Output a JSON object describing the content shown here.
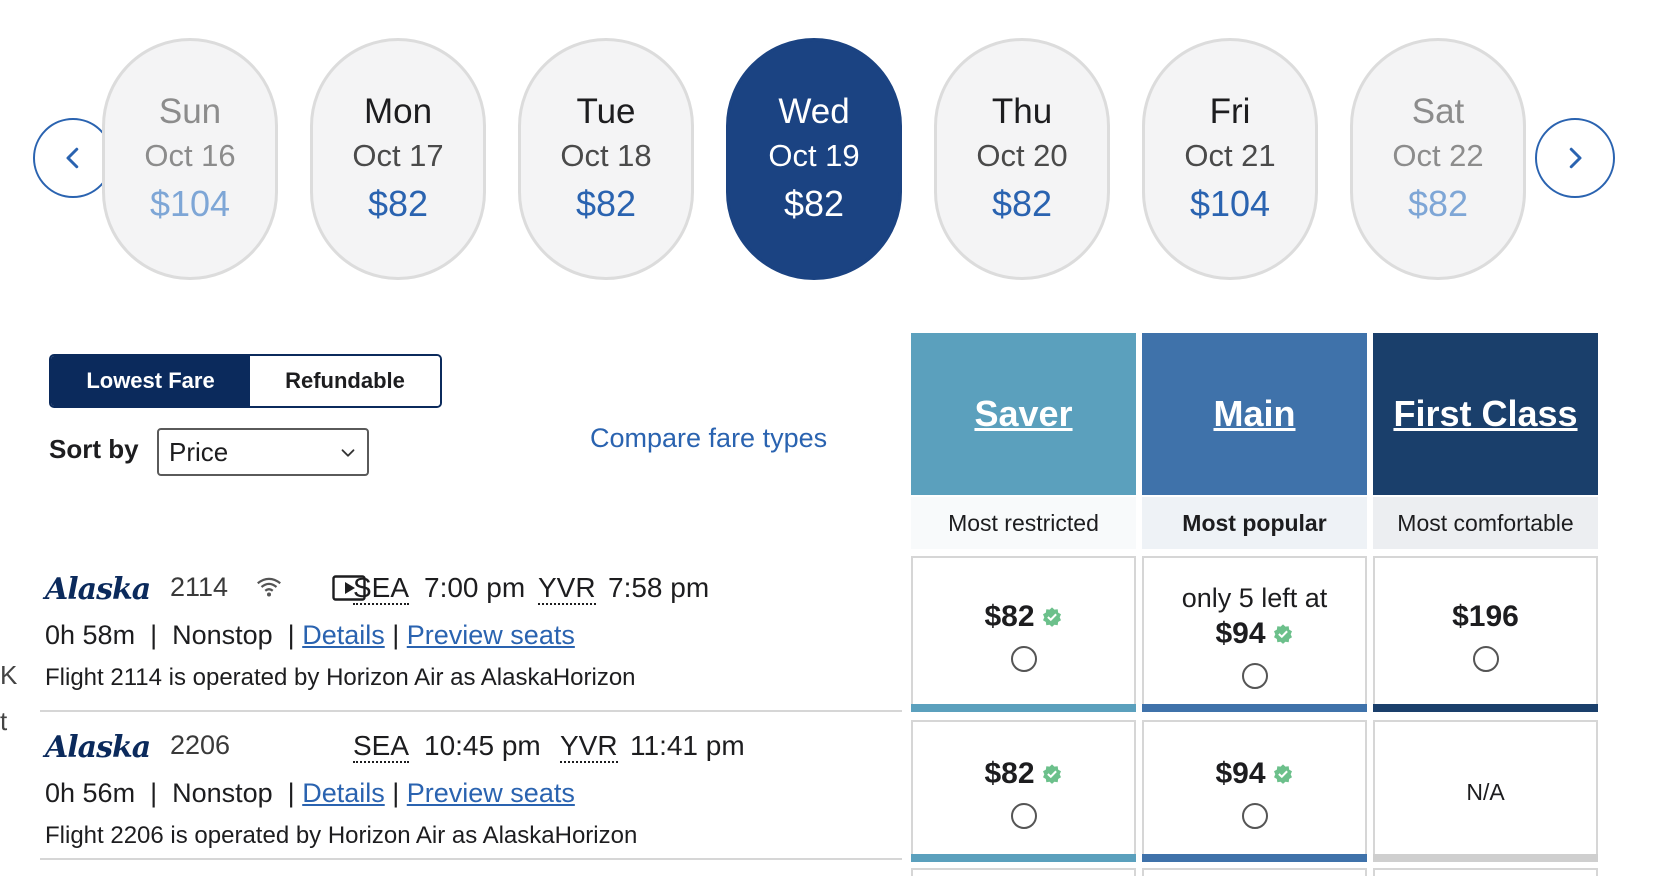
{
  "carousel": {
    "days": [
      {
        "dow": "Sun",
        "date": "Oct 16",
        "price": "$104"
      },
      {
        "dow": "Mon",
        "date": "Oct 17",
        "price": "$82"
      },
      {
        "dow": "Tue",
        "date": "Oct 18",
        "price": "$82"
      },
      {
        "dow": "Wed",
        "date": "Oct 19",
        "price": "$82"
      },
      {
        "dow": "Thu",
        "date": "Oct 20",
        "price": "$82"
      },
      {
        "dow": "Fri",
        "date": "Oct 21",
        "price": "$104"
      },
      {
        "dow": "Sat",
        "date": "Oct 22",
        "price": "$82"
      }
    ],
    "selected_index": 3,
    "prev_icon": "chevron-left-icon",
    "next_icon": "chevron-right-icon"
  },
  "filters": {
    "toggle": {
      "lowest": "Lowest Fare",
      "refundable": "Refundable",
      "active": "Lowest Fare"
    },
    "sort_label": "Sort by",
    "sort_value": "Price",
    "compare_link": "Compare fare types"
  },
  "fare_columns": [
    {
      "name": "Saver",
      "subtitle": "Most restricted",
      "color": "#5ba0bd"
    },
    {
      "name": "Main",
      "subtitle": "Most popular",
      "color": "#3f72aa"
    },
    {
      "name": "First Class",
      "subtitle": "Most comfortable",
      "color": "#1a3f6b"
    }
  ],
  "flights": [
    {
      "airline": "Alaska",
      "number": "2114",
      "amenities": [
        "wifi-icon",
        "entertainment-icon"
      ],
      "from": "SEA",
      "depart": "7:00 pm",
      "to": "YVR",
      "arrive": "7:58 pm",
      "duration": "0h 58m",
      "stops": "Nonstop",
      "details_link": "Details",
      "seats_link": "Preview seats",
      "operated_by": "Flight 2114 is operated by Horizon Air as AlaskaHorizon",
      "fares": {
        "saver": {
          "price": "$82",
          "note": ""
        },
        "main": {
          "price": "$94",
          "note": "only 5 left at"
        },
        "first": {
          "price": "$196",
          "note": ""
        }
      }
    },
    {
      "airline": "Alaska",
      "number": "2206",
      "amenities": [],
      "from": "SEA",
      "depart": "10:45 pm",
      "to": "YVR",
      "arrive": "11:41 pm",
      "duration": "0h 56m",
      "stops": "Nonstop",
      "details_link": "Details",
      "seats_link": "Preview seats",
      "operated_by": "Flight 2206 is operated by Horizon Air as AlaskaHorizon",
      "fares": {
        "saver": {
          "price": "$82",
          "note": ""
        },
        "main": {
          "price": "$94",
          "note": ""
        },
        "first": {
          "price": "N/A",
          "note": ""
        }
      }
    }
  ],
  "edge_text": {
    "k": "K",
    "t": "t"
  },
  "colors": {
    "accent": "#2a63b0",
    "selected_day": "#1b4382",
    "toggle_active": "#0b2a5c",
    "check": "#6cc08b"
  }
}
